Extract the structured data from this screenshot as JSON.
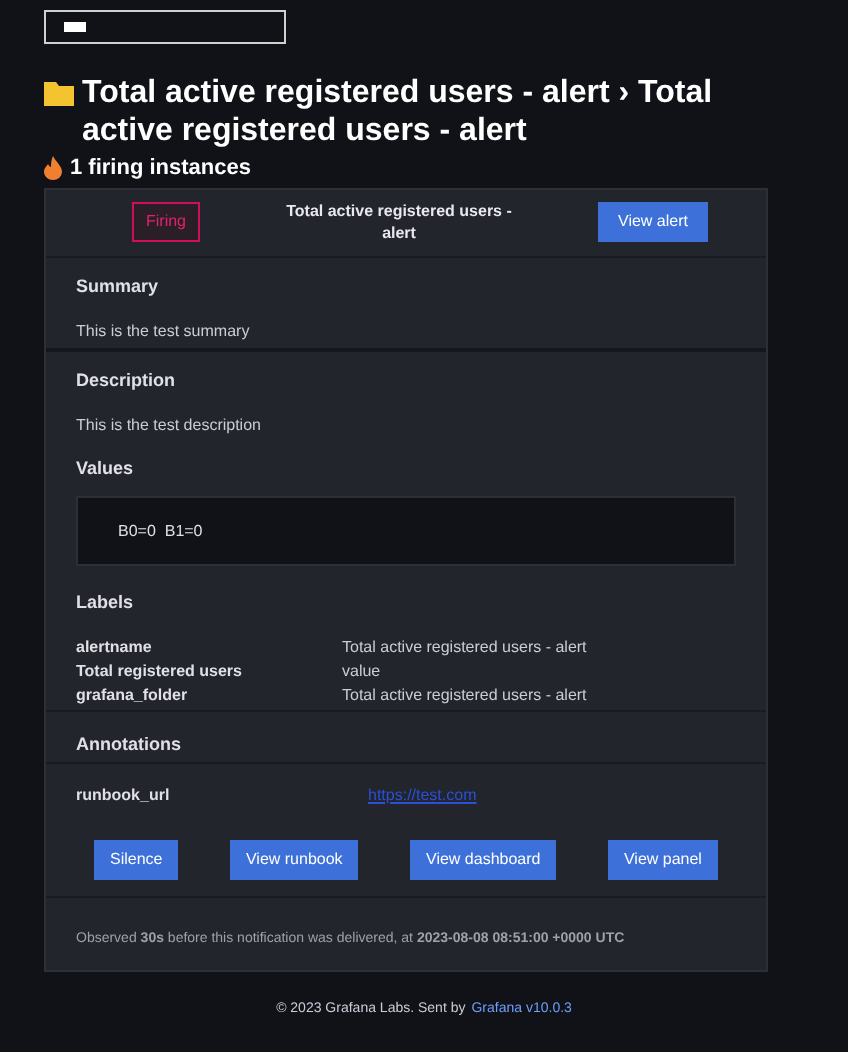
{
  "header": {
    "title": "Total active registered users - alert › Total active registered users - alert",
    "firing_count": "1 firing instances"
  },
  "alert": {
    "status": "Firing",
    "name": "Total active registered users - alert",
    "view_button": "View alert"
  },
  "summary": {
    "heading": "Summary",
    "text": "This is the test summary"
  },
  "description": {
    "heading": "Description",
    "text": "This is the test description"
  },
  "values": {
    "heading": "Values",
    "text": "B0=0  B1=0"
  },
  "labels": {
    "heading": "Labels",
    "rows": [
      {
        "key": "alertname",
        "value": "Total active registered users - alert"
      },
      {
        "key": "Total registered users",
        "value": "value"
      },
      {
        "key": "grafana_folder",
        "value": "Total active registered users - alert"
      }
    ]
  },
  "annotations": {
    "heading": "Annotations",
    "rows": [
      {
        "key": "runbook_url",
        "value": "https://test.com"
      }
    ]
  },
  "buttons": [
    "Silence",
    "View runbook",
    "View dashboard",
    "View panel"
  ],
  "observed": "Observed **30s** before this notification was delivered, at **2023-08-08 08:51:00 +0000 UTC**",
  "footer": {
    "text": "© 2023 Grafana Labs. Sent by",
    "link": "Grafana v10.0.3"
  }
}
